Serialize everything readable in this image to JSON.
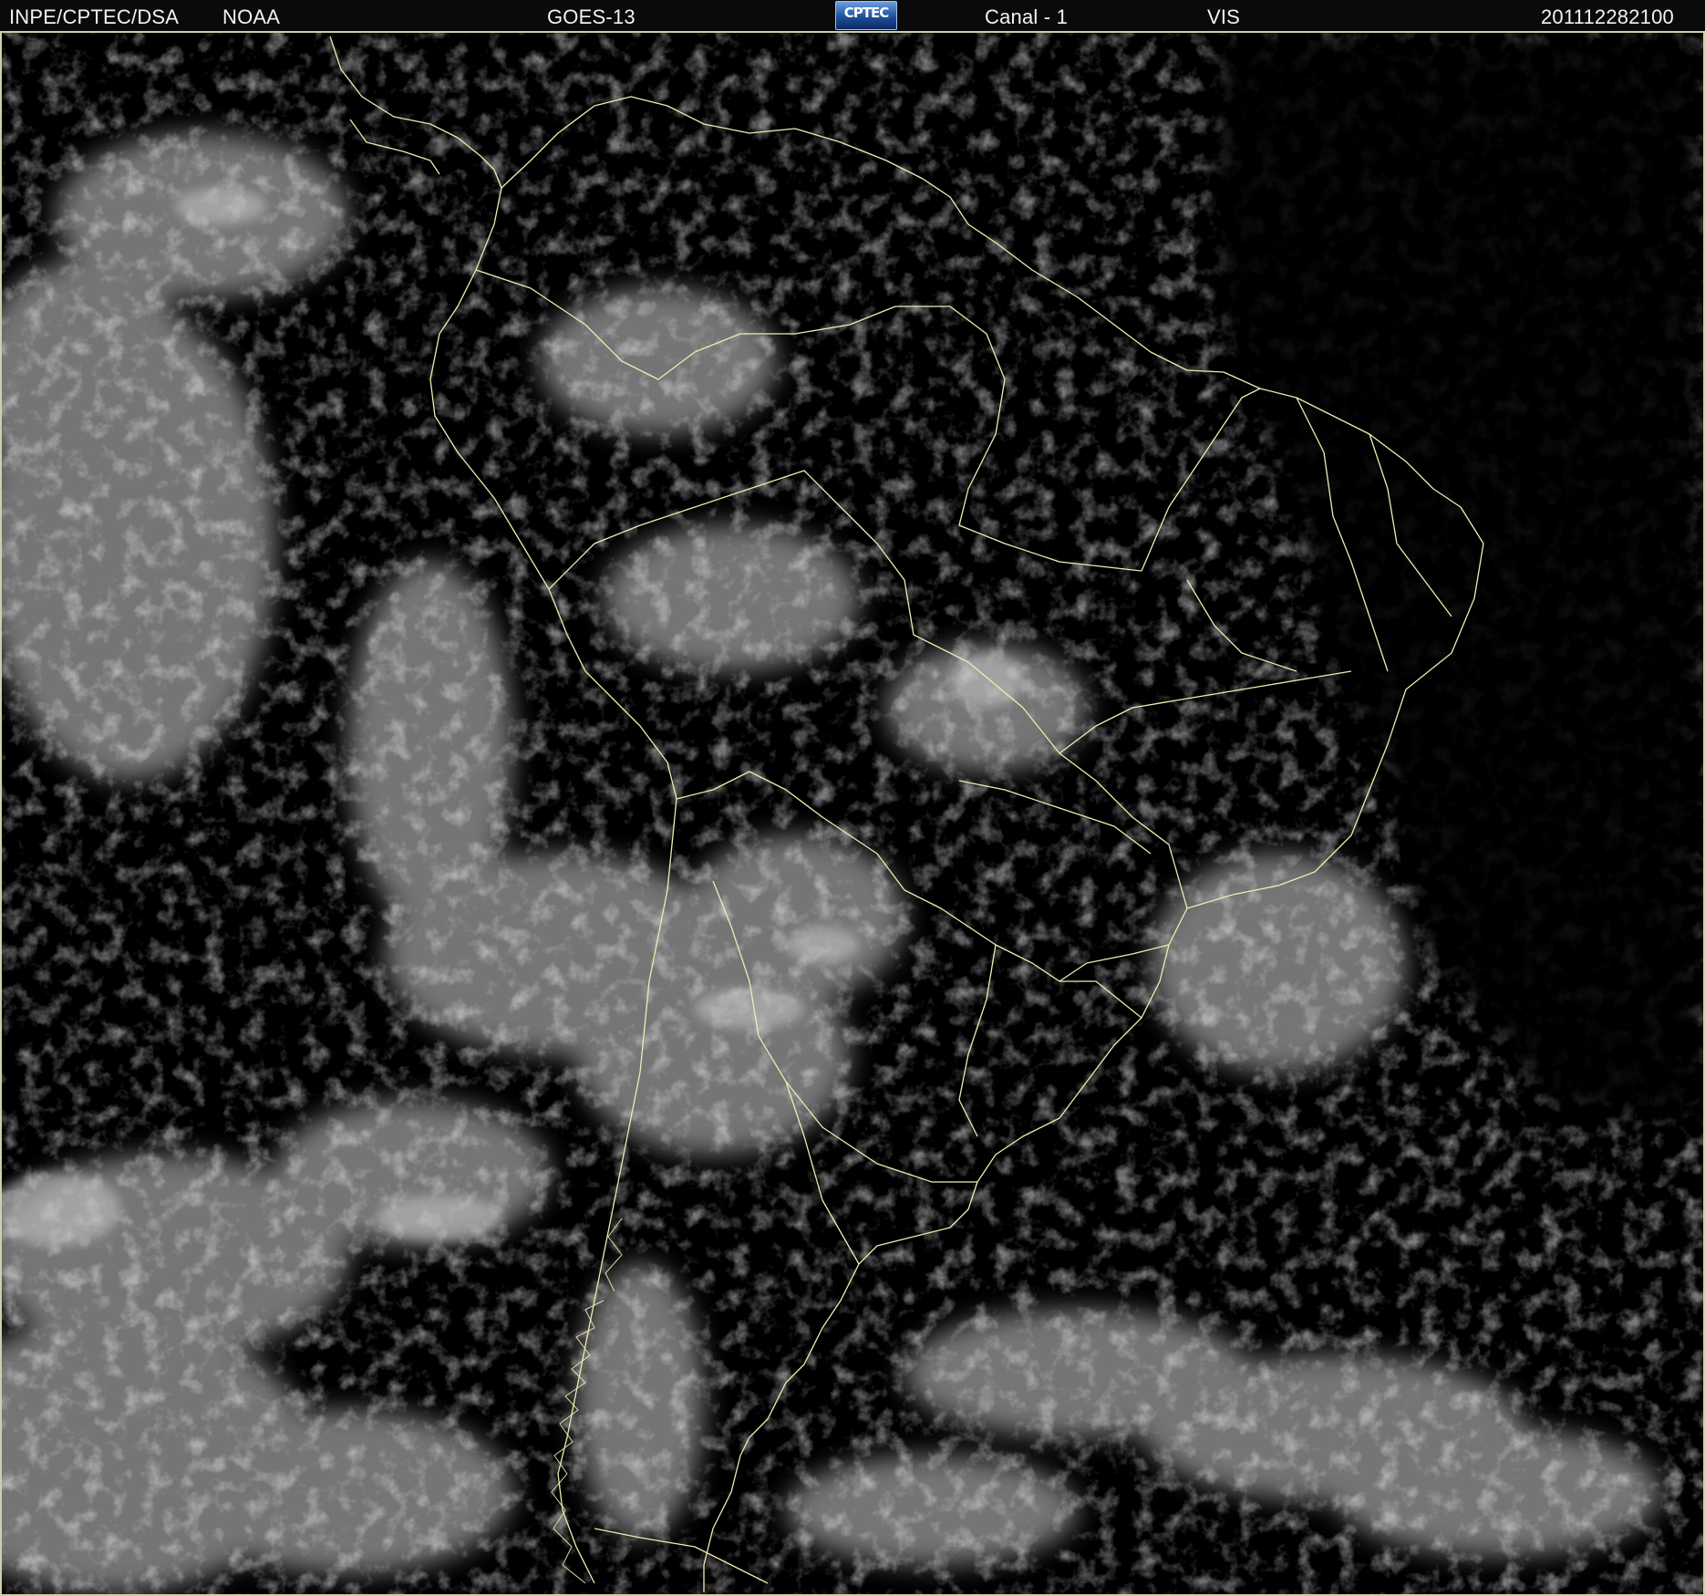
{
  "header": {
    "institution": "INPE/CPTEC/DSA",
    "agency": "NOAA",
    "satellite": "GOES-13",
    "logo_text": "CPTEC",
    "channel": "Canal - 1",
    "band": "VIS",
    "timestamp": "201112282100"
  },
  "colors": {
    "background": "#000000",
    "header_text": "#f2f2f2",
    "coastline": "#f0ecb0",
    "cloud": "#b8b8b8",
    "logo_blue": "#1f4f9a"
  },
  "icons": {
    "logo": "cptec-logo"
  }
}
